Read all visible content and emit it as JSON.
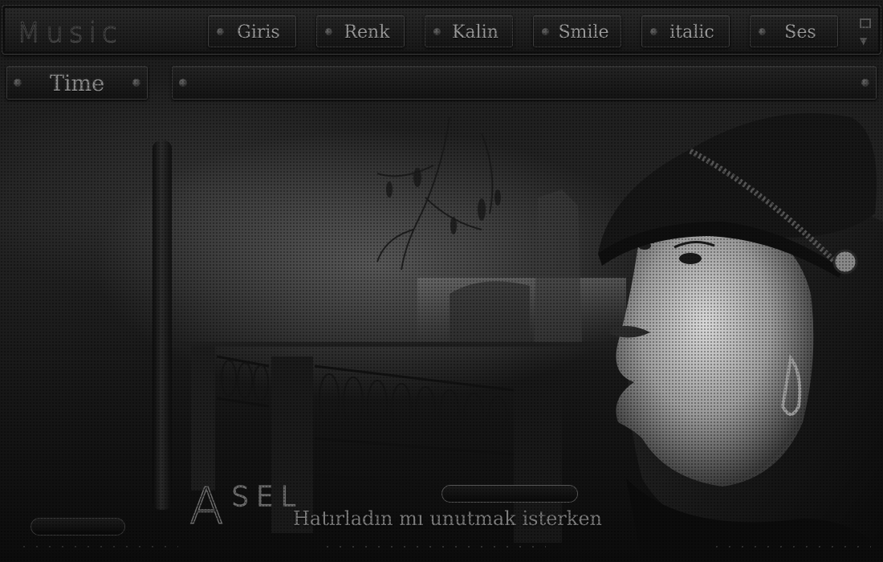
{
  "app": {
    "logo": "Music"
  },
  "nav": {
    "items": [
      "Giris",
      "Renk",
      "Kalin",
      "Smile",
      "italic",
      "Ses"
    ]
  },
  "player": {
    "time_label": "Time",
    "track_text": ""
  },
  "branding": {
    "logo_initial": "A",
    "logo_rest": "SEL",
    "lyric": "Hatırladın mı unutmak isterken"
  },
  "colors": {
    "background": "#1a1a1a",
    "panel": "#1f1f1f",
    "text": "#9a9a9a",
    "border": "#3a3a3a"
  },
  "icons": {
    "maximize": "square-icon",
    "minimize": "minimize-icon",
    "nav_bullet": "dot-icon"
  }
}
